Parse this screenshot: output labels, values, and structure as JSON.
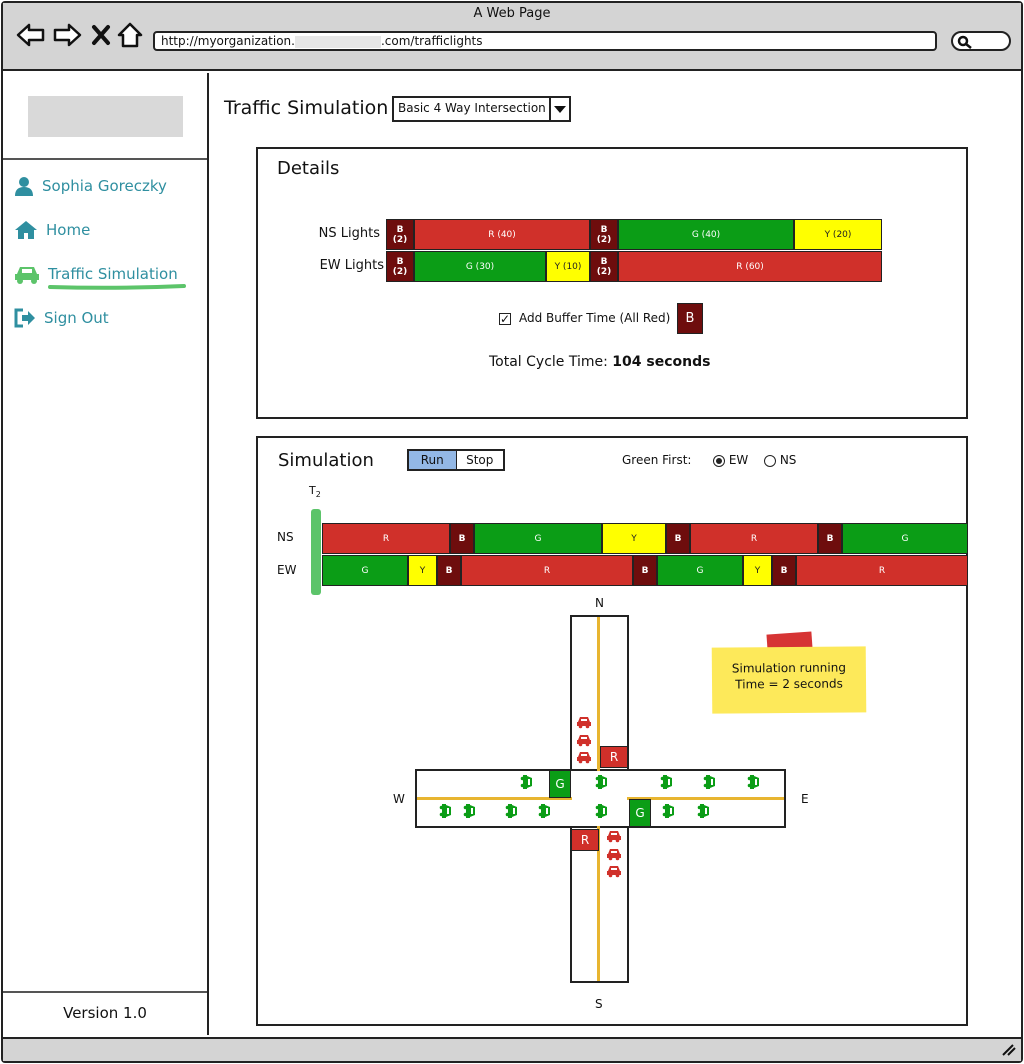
{
  "browser": {
    "title": "A Web Page",
    "url_prefix": "http://myorganization.",
    "url_suffix": ".com/trafficlights"
  },
  "sidebar": {
    "user": "Sophia Goreczky",
    "items": [
      {
        "label": "Home",
        "icon": "home-icon"
      },
      {
        "label": "Traffic Simulation",
        "icon": "car-icon",
        "active": true
      },
      {
        "label": "Sign Out",
        "icon": "sign-out-icon"
      }
    ],
    "version": "Version 1.0"
  },
  "header": {
    "title": "Traffic Simulation",
    "scenario": "Basic 4 Way Intersection"
  },
  "details": {
    "title": "Details",
    "ns_label": "NS Lights",
    "ew_label": "EW Lights",
    "ns_segments": [
      {
        "state": "B",
        "label": "B (2)",
        "seconds": 2
      },
      {
        "state": "R",
        "label": "R (40)",
        "seconds": 40
      },
      {
        "state": "B",
        "label": "B (2)",
        "seconds": 2
      },
      {
        "state": "G",
        "label": "G (40)",
        "seconds": 40
      },
      {
        "state": "Y",
        "label": "Y (20)",
        "seconds": 20
      }
    ],
    "ew_segments": [
      {
        "state": "B",
        "label": "B (2)",
        "seconds": 2
      },
      {
        "state": "G",
        "label": "G (30)",
        "seconds": 30
      },
      {
        "state": "Y",
        "label": "Y (10)",
        "seconds": 10
      },
      {
        "state": "B",
        "label": "B (2)",
        "seconds": 2
      },
      {
        "state": "R",
        "label": "R (60)",
        "seconds": 60
      }
    ],
    "buffer_label": "Add Buffer Time (All Red)",
    "buffer_checked": true,
    "buffer_button": "B",
    "total_label": "Total Cycle Time:",
    "total_value": "104 seconds"
  },
  "simulation": {
    "title": "Simulation",
    "run_label": "Run",
    "stop_label": "Stop",
    "green_first_label": "Green First:",
    "options": [
      "EW",
      "NS"
    ],
    "selected": "EW",
    "time_marker": "T",
    "time_marker_sub": "2",
    "ns_label": "NS",
    "ew_label": "EW",
    "ns_timeline": [
      "R",
      "B",
      "G",
      "Y",
      "B",
      "R",
      "B",
      "G"
    ],
    "ew_timeline": [
      "G",
      "Y",
      "B",
      "R",
      "B",
      "G",
      "Y",
      "B",
      "R"
    ],
    "note_line1": "Simulation running",
    "note_line2": "Time = 2 seconds",
    "directions": {
      "n": "N",
      "s": "S",
      "w": "W",
      "e": "E"
    },
    "lights": {
      "north": "R",
      "south": "R",
      "west": "G",
      "east": "G"
    },
    "colors": {
      "red": "#d0302a",
      "green": "#0b9d16",
      "yellow": "#ffff00",
      "buffer": "#6e0d0d",
      "accent": "#2f8fa0"
    }
  }
}
